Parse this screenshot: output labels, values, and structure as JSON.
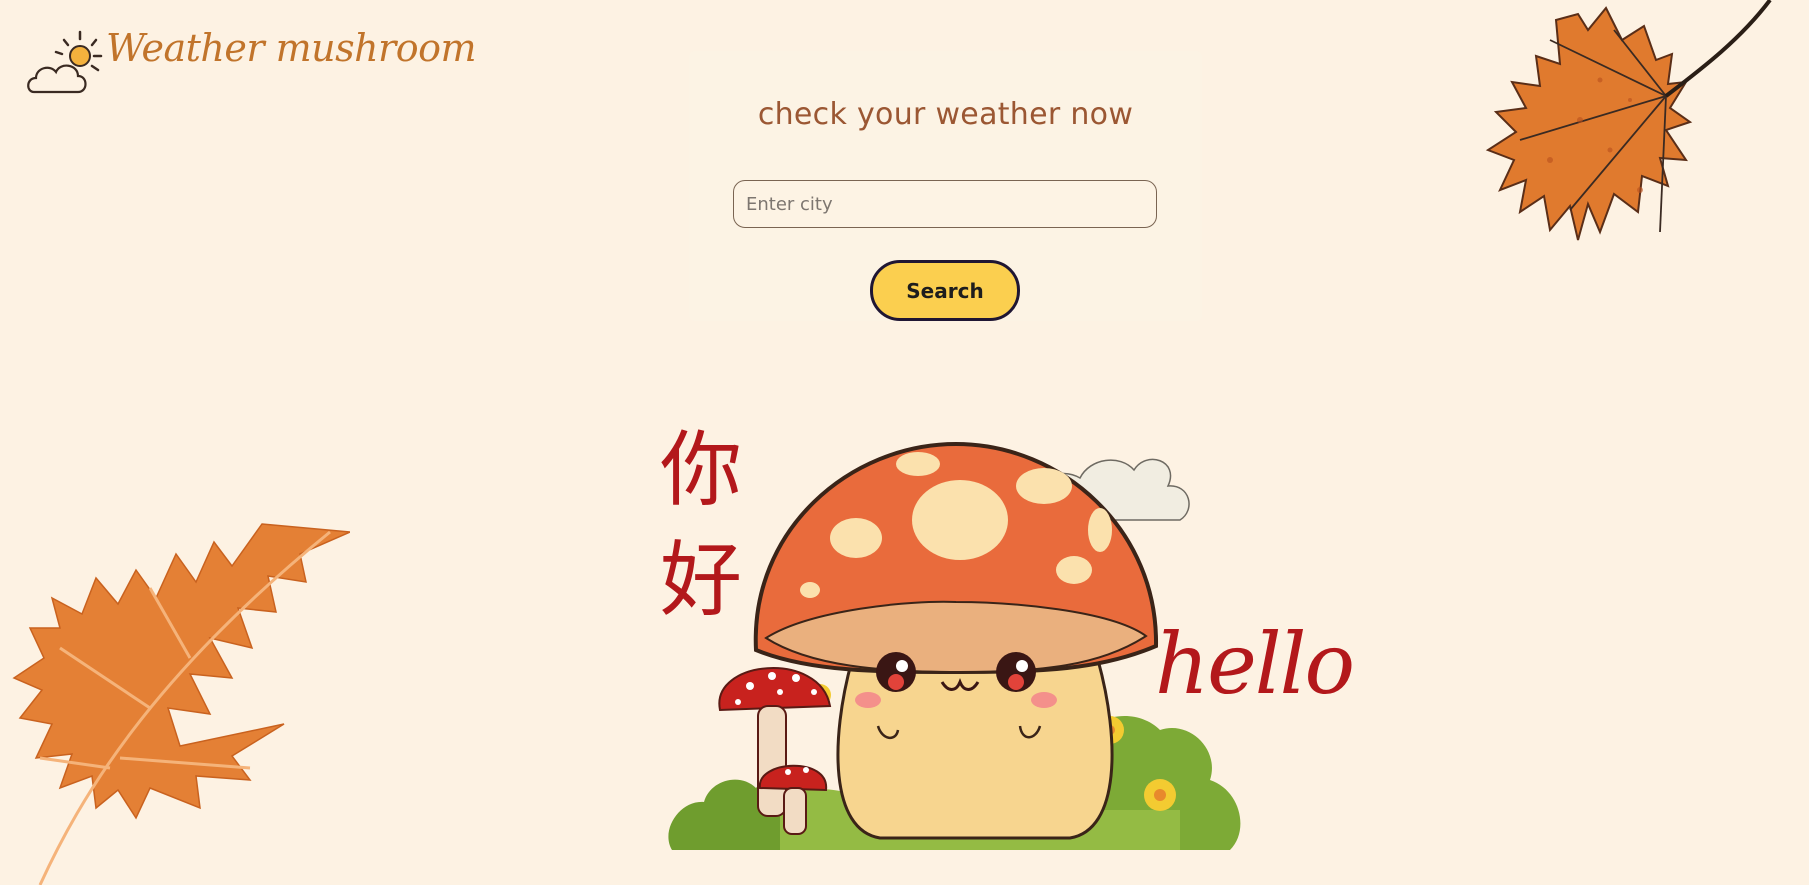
{
  "brand": {
    "name": "Weather mushroom",
    "logo_icon": "sun-behind-cloud-icon"
  },
  "search": {
    "heading": "check your weather now",
    "placeholder": "Enter city",
    "value": "",
    "button_label": "Search"
  },
  "illustration": {
    "greeting_cjk_1": "你",
    "greeting_cjk_2": "好",
    "greeting_en": "hello"
  },
  "colors": {
    "background": "#fdf2e3",
    "brand_text": "#c1742b",
    "heading_text": "#9b5733",
    "button_fill": "#fbcf4f",
    "button_border": "#1f1633",
    "greeting_red": "#b3181b",
    "leaf_orange": "#e07a2e"
  }
}
